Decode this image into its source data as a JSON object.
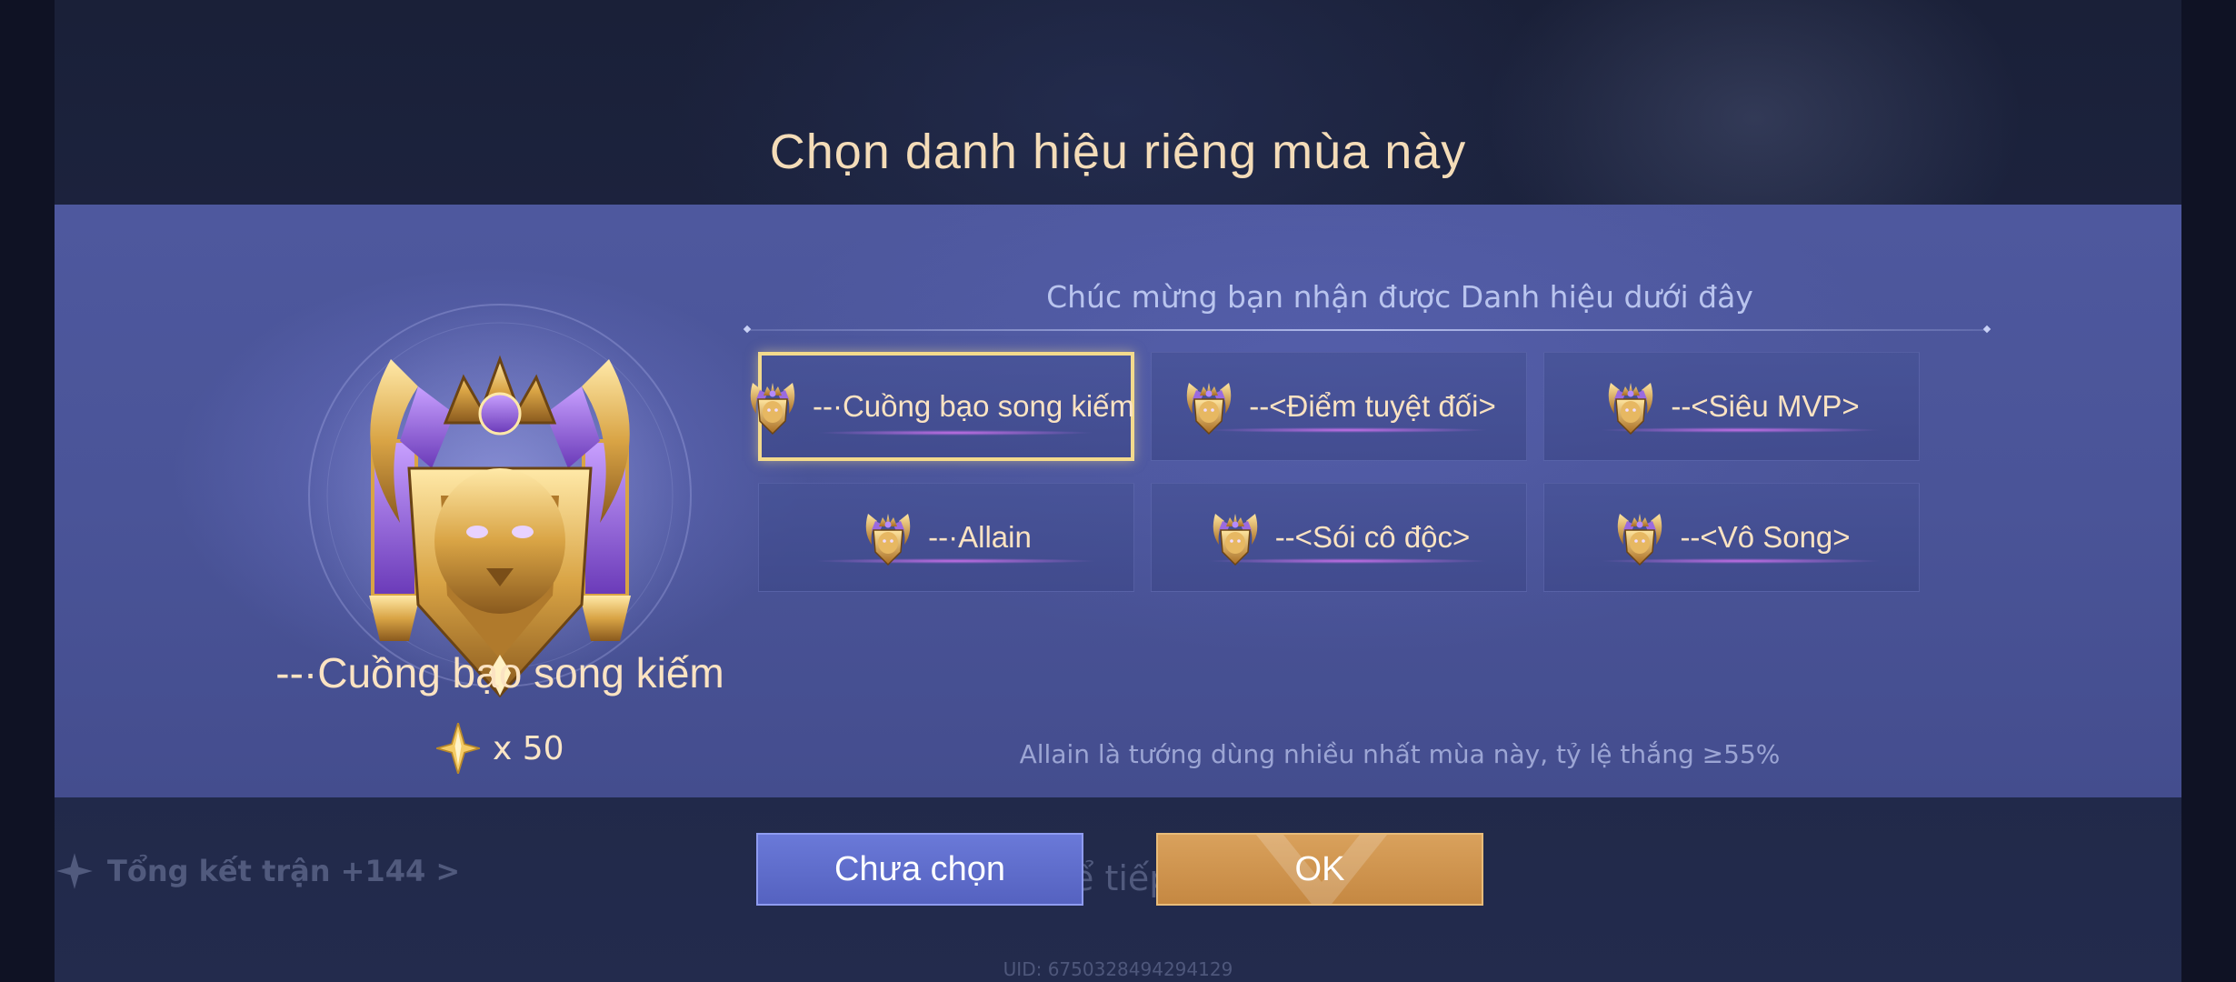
{
  "header": {
    "title": "Chọn danh hiệu riêng mùa này"
  },
  "left": {
    "title_name": "--·Cuồng bạo song kiếm",
    "reward_count": "x 50",
    "reward_icon": "star-crystal-icon"
  },
  "right": {
    "congrats": "Chúc mừng bạn nhận được Danh hiệu dưới đây",
    "titles": [
      {
        "label": "--·Cuồng bạo song kiếm",
        "selected": true
      },
      {
        "label": "--<Điểm tuyệt đối>",
        "selected": false
      },
      {
        "label": "--<Siêu MVP>",
        "selected": false
      },
      {
        "label": "--·Allain",
        "selected": false
      },
      {
        "label": "--<Sói cô độc>",
        "selected": false
      },
      {
        "label": "--<Vô Song>",
        "selected": false
      }
    ],
    "note": "Allain là tướng dùng nhiều nhất mùa này, tỷ lệ thắng ≥55%"
  },
  "buttons": {
    "left_label": "Chưa chọn",
    "ok_label": "OK"
  },
  "background": {
    "summary": "Tổng kết trận +144 >",
    "continue_fragment": "ể tiếp",
    "uid": "UID: 6750328494294129"
  },
  "colors": {
    "title": "#f4dcb8",
    "panel": "#4a5498",
    "selected_border": "#f3da8c",
    "button_blue": "#5f6dcc",
    "button_gold": "#cf9550"
  }
}
